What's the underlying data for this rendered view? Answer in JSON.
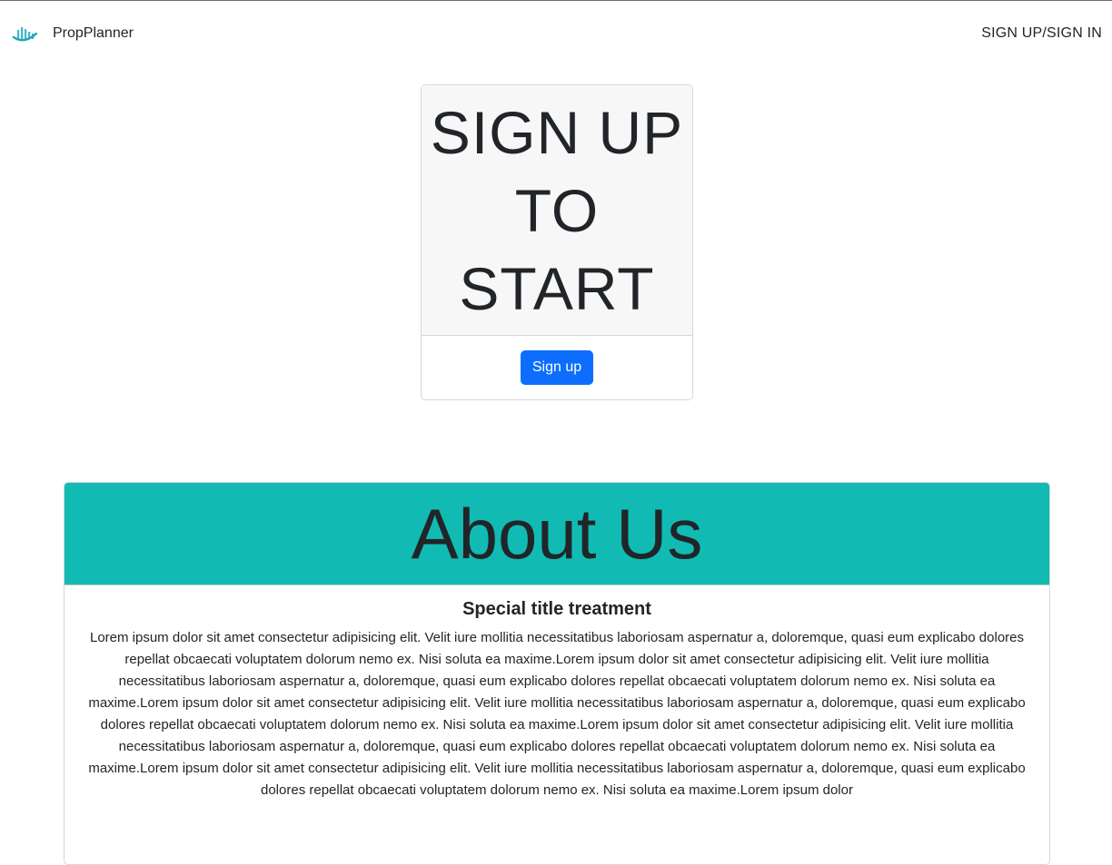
{
  "navbar": {
    "brand_name": "PropPlanner",
    "logo_icon": "city-skyline-icon",
    "auth_link": "SIGN UP/SIGN IN"
  },
  "signup_card": {
    "heading_lines": [
      "SIGN UP",
      "TO",
      "START"
    ],
    "button_label": "Sign up"
  },
  "about": {
    "heading": "About Us",
    "subtitle": "Special title treatment",
    "body_text": "Lorem ipsum dolor sit amet consectetur adipisicing elit. Velit iure mollitia necessitatibus laboriosam aspernatur a, doloremque, quasi eum explicabo dolores repellat obcaecati voluptatem dolorum nemo ex. Nisi soluta ea maxime.Lorem ipsum dolor sit amet consectetur adipisicing elit. Velit iure mollitia necessitatibus laboriosam aspernatur a, doloremque, quasi eum explicabo dolores repellat obcaecati voluptatem dolorum nemo ex. Nisi soluta ea maxime.Lorem ipsum dolor sit amet consectetur adipisicing elit. Velit iure mollitia necessitatibus laboriosam aspernatur a, doloremque, quasi eum explicabo dolores repellat obcaecati voluptatem dolorum nemo ex. Nisi soluta ea maxime.Lorem ipsum dolor sit amet consectetur adipisicing elit. Velit iure mollitia necessitatibus laboriosam aspernatur a, doloremque, quasi eum explicabo dolores repellat obcaecati voluptatem dolorum nemo ex. Nisi soluta ea maxime.Lorem ipsum dolor sit amet consectetur adipisicing elit. Velit iure mollitia necessitatibus laboriosam aspernatur a, doloremque, quasi eum explicabo dolores repellat obcaecati voluptatem dolorum nemo ex. Nisi soluta ea maxime.Lorem ipsum dolor"
  },
  "colors": {
    "accent_teal": "#11bbb3",
    "primary_button": "#0d6efd",
    "card_header_gray": "#f7f7f7"
  }
}
